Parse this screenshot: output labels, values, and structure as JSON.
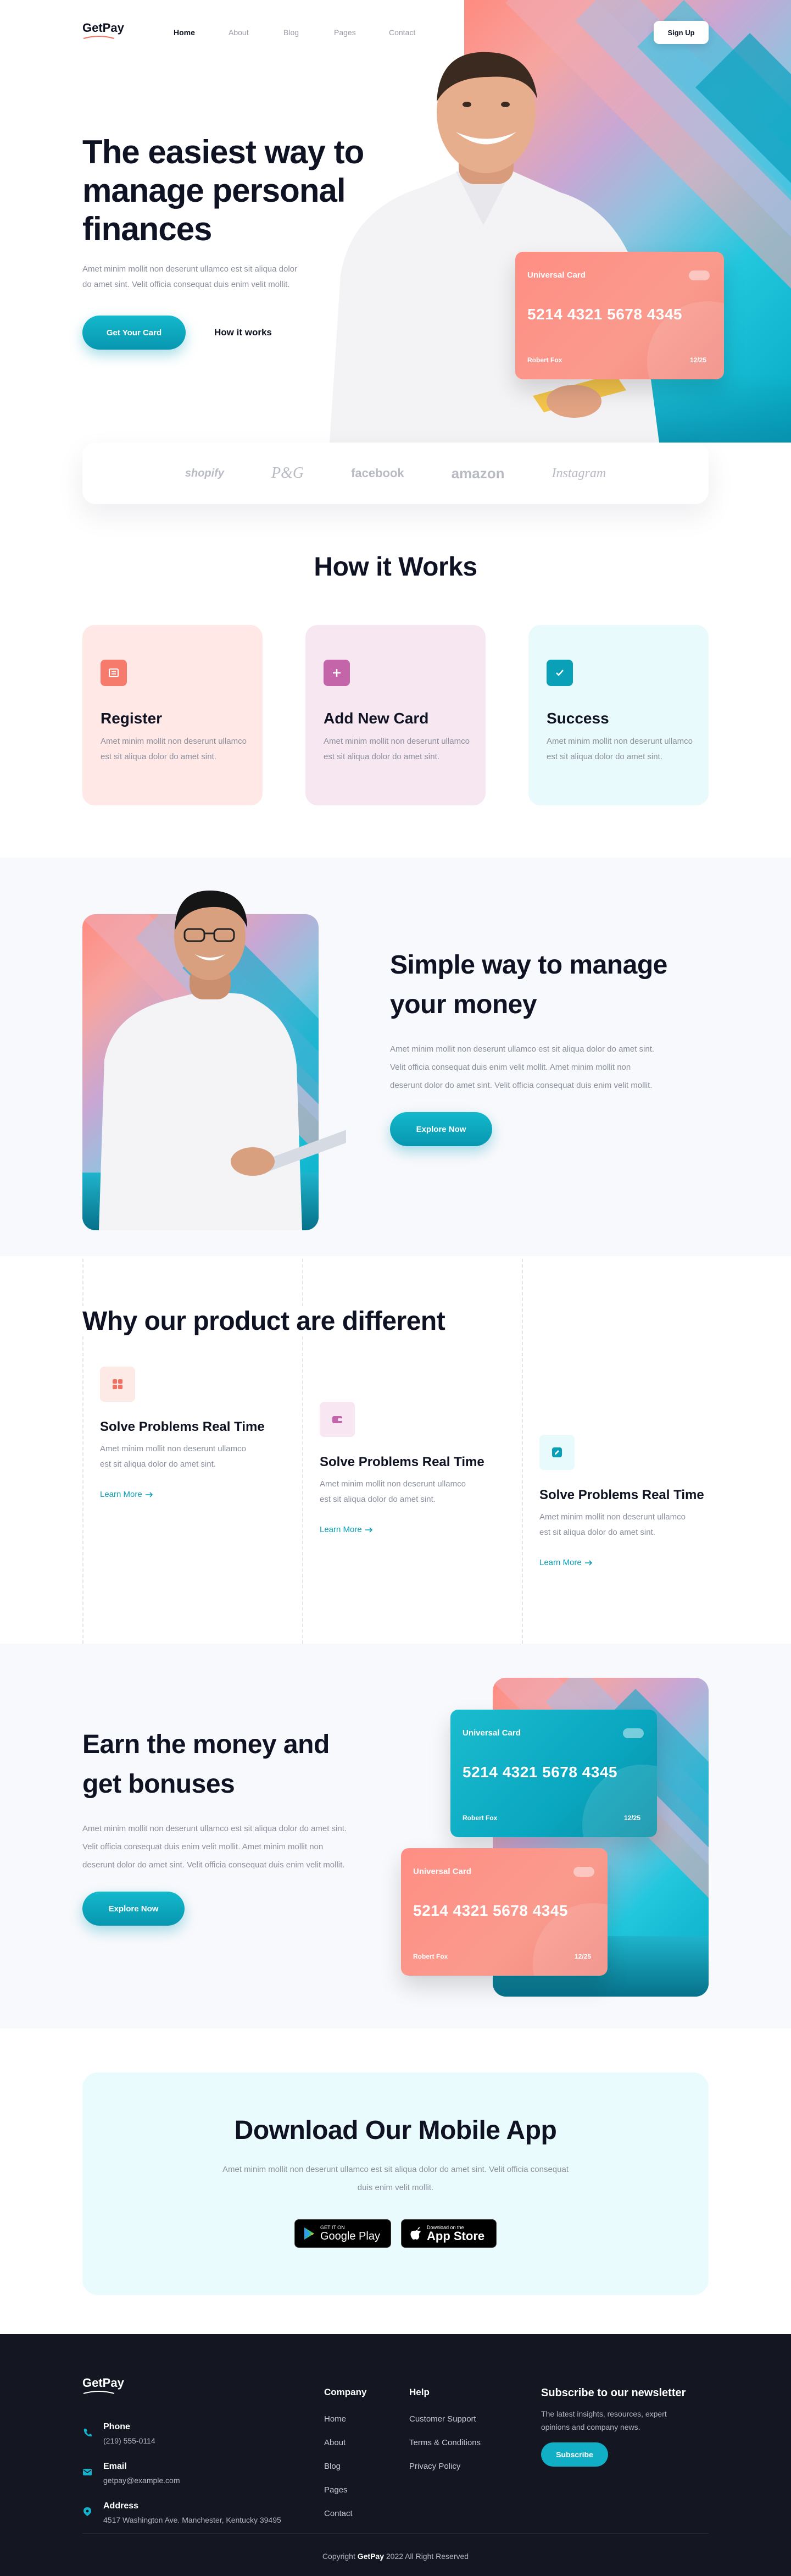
{
  "nav": {
    "logo": "GetPay",
    "items": [
      "Home",
      "About",
      "Blog",
      "Pages",
      "Contact"
    ],
    "signup": "Sign Up"
  },
  "hero": {
    "title_line1": "The easiest way to",
    "title_line2": "manage personal",
    "title_line3": "finances",
    "text": "Amet minim mollit non deserunt ullamco est sit aliqua dolor do amet sint. Velit officia consequat duis enim velit mollit.",
    "cta": "Get Your Card",
    "secondary": "How it works",
    "card": {
      "title": "Universal Card",
      "number": "5214 4321 5678 4345",
      "holder": "Robert Fox",
      "expiry": "12/25"
    }
  },
  "brands": [
    "shopify",
    "P&G",
    "facebook",
    "amazon",
    "Instagram"
  ],
  "how": {
    "title": "How it Works",
    "items": [
      {
        "title": "Register",
        "text": "Amet minim mollit non deserunt ullamco est sit aliqua dolor do amet sint."
      },
      {
        "title": "Add New Card",
        "text": "Amet minim mollit non deserunt ullamco est sit aliqua dolor do amet sint."
      },
      {
        "title": "Success",
        "text": "Amet minim mollit non deserunt ullamco est sit aliqua dolor do amet sint."
      }
    ]
  },
  "simple": {
    "title_line1": "Simple way to manage",
    "title_line2": "your money",
    "text": "Amet minim mollit non deserunt ullamco est sit aliqua dolor do amet sint. Velit officia consequat duis enim velit mollit. Amet minim mollit non deserunt  dolor do amet sint. Velit officia consequat duis enim velit mollit.",
    "cta": "Explore Now"
  },
  "different": {
    "title": "Why our product are different",
    "items": [
      {
        "title": "Solve Problems Real Time",
        "text": "Amet minim mollit non deserunt ullamco est sit aliqua dolor do amet sint.",
        "link": "Learn More"
      },
      {
        "title": "Solve Problems Real Time",
        "text": "Amet minim mollit non deserunt ullamco est sit aliqua dolor do amet sint.",
        "link": "Learn More"
      },
      {
        "title": "Solve Problems Real Time",
        "text": "Amet minim mollit non deserunt ullamco est sit aliqua dolor do amet sint.",
        "link": "Learn More"
      }
    ]
  },
  "earn": {
    "title_line1": "Earn the money and",
    "title_line2": "get bonuses",
    "text": "Amet minim mollit non deserunt ullamco est sit aliqua dolor do amet sint. Velit officia consequat duis enim velit mollit. Amet minim mollit non deserunt  dolor do amet sint. Velit officia consequat duis enim velit mollit.",
    "cta": "Explore Now",
    "card_teal": {
      "title": "Universal Card",
      "number": "5214 4321 5678 4345",
      "holder": "Robert Fox",
      "expiry": "12/25"
    },
    "card_coral": {
      "title": "Universal Card",
      "number": "5214 4321 5678 4345",
      "holder": "Robert Fox",
      "expiry": "12/25"
    }
  },
  "download": {
    "title": "Download Our Mobile App",
    "text": "Amet minim mollit non deserunt ullamco est sit aliqua dolor do amet sint. Velit officia consequat duis enim velit mollit.",
    "google_small": "GET IT ON",
    "google_big": "Google Play",
    "apple_small": "Download on the",
    "apple_big": "App Store"
  },
  "footer": {
    "logo": "GetPay",
    "contacts": [
      {
        "label": "Phone",
        "value": "(219) 555-0114"
      },
      {
        "label": "Email",
        "value": "getpay@example.com"
      },
      {
        "label": "Address",
        "value": "4517 Washington Ave. Manchester, Kentucky 39495"
      }
    ],
    "company_title": "Company",
    "company_links": [
      "Home",
      "About",
      "Blog",
      "Pages",
      "Contact"
    ],
    "help_title": "Help",
    "help_links": [
      "Customer Support",
      "Terms & Conditions",
      "Privacy Policy"
    ],
    "newsletter_title": "Subscribe to our newsletter",
    "newsletter_text": "The latest insights, resources, expert opinions and company news.",
    "subscribe": "Subscribe",
    "copyright_pre": "Copyright ",
    "copyright_brand": "GetPay",
    "copyright_post": " 2022 All Right Reserved"
  },
  "colors": {
    "accent": "#0aa7c0",
    "coral": "#ff8e84",
    "dark": "#141622"
  }
}
